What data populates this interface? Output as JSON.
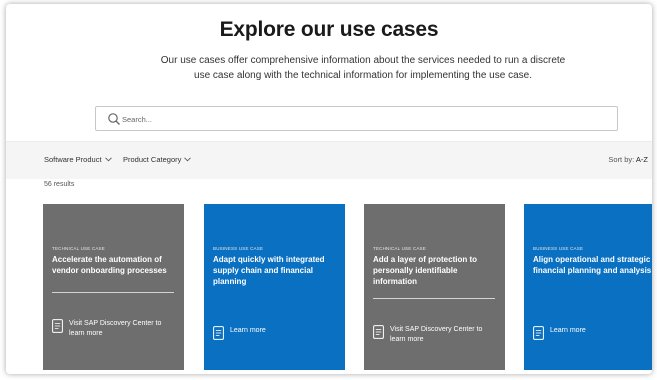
{
  "hero": {
    "title": "Explore our use cases",
    "subtitle": "Our use cases offer comprehensive information about the services needed to run a discrete use case along with the technical information for implementing the use case."
  },
  "search": {
    "placeholder": "Search..."
  },
  "filters": {
    "software_product": "Software Product",
    "product_category": "Product Category",
    "sort_label": "Sort by:",
    "sort_value": "A-Z"
  },
  "results": "56 results",
  "cards": [
    {
      "eyebrow": "TECHNICAL USE CASE",
      "title": "Accelerate the automation of vendor onboarding processes",
      "cta": "Visit SAP Discovery Center to learn more",
      "color": "#6e6e6e"
    },
    {
      "eyebrow": "BUSINESS USE CASE",
      "title": "Adapt quickly with integrated supply chain and financial planning",
      "cta": "Learn more",
      "color": "#0a70c2"
    },
    {
      "eyebrow": "TECHNICAL USE CASE",
      "title": "Add a layer of protection to personally identifiable information",
      "cta": "Visit SAP Discovery Center to learn more",
      "color": "#6e6e6e"
    },
    {
      "eyebrow": "BUSINESS USE CASE",
      "title": "Align operational and strategic financial planning and analysis",
      "cta": "Learn more",
      "color": "#0a70c2"
    }
  ],
  "icons": {
    "search": "search-icon",
    "chevron": "chevron-down-icon",
    "document": "document-icon"
  }
}
